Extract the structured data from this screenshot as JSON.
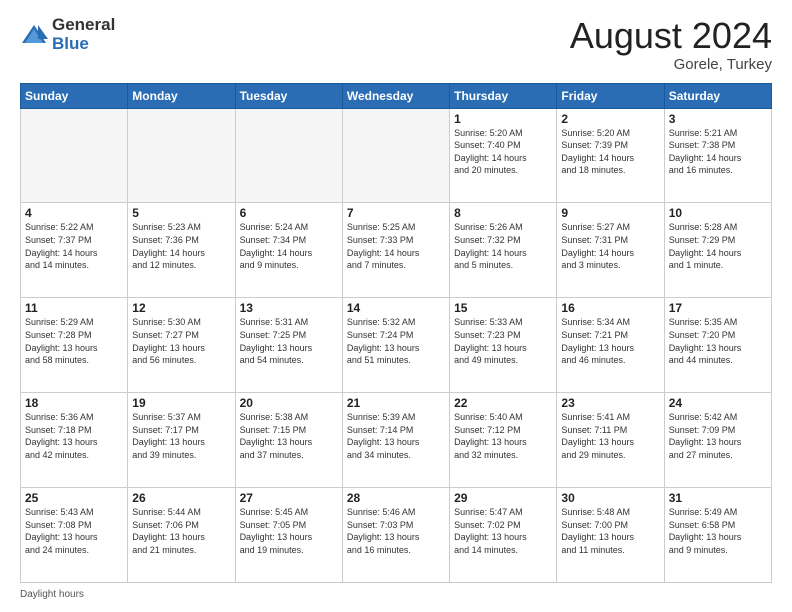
{
  "header": {
    "logo_general": "General",
    "logo_blue": "Blue",
    "month_title": "August 2024",
    "location": "Gorele, Turkey"
  },
  "footer": {
    "daylight_label": "Daylight hours"
  },
  "weekdays": [
    "Sunday",
    "Monday",
    "Tuesday",
    "Wednesday",
    "Thursday",
    "Friday",
    "Saturday"
  ],
  "weeks": [
    [
      {
        "day": "",
        "info": ""
      },
      {
        "day": "",
        "info": ""
      },
      {
        "day": "",
        "info": ""
      },
      {
        "day": "",
        "info": ""
      },
      {
        "day": "1",
        "info": "Sunrise: 5:20 AM\nSunset: 7:40 PM\nDaylight: 14 hours\nand 20 minutes."
      },
      {
        "day": "2",
        "info": "Sunrise: 5:20 AM\nSunset: 7:39 PM\nDaylight: 14 hours\nand 18 minutes."
      },
      {
        "day": "3",
        "info": "Sunrise: 5:21 AM\nSunset: 7:38 PM\nDaylight: 14 hours\nand 16 minutes."
      }
    ],
    [
      {
        "day": "4",
        "info": "Sunrise: 5:22 AM\nSunset: 7:37 PM\nDaylight: 14 hours\nand 14 minutes."
      },
      {
        "day": "5",
        "info": "Sunrise: 5:23 AM\nSunset: 7:36 PM\nDaylight: 14 hours\nand 12 minutes."
      },
      {
        "day": "6",
        "info": "Sunrise: 5:24 AM\nSunset: 7:34 PM\nDaylight: 14 hours\nand 9 minutes."
      },
      {
        "day": "7",
        "info": "Sunrise: 5:25 AM\nSunset: 7:33 PM\nDaylight: 14 hours\nand 7 minutes."
      },
      {
        "day": "8",
        "info": "Sunrise: 5:26 AM\nSunset: 7:32 PM\nDaylight: 14 hours\nand 5 minutes."
      },
      {
        "day": "9",
        "info": "Sunrise: 5:27 AM\nSunset: 7:31 PM\nDaylight: 14 hours\nand 3 minutes."
      },
      {
        "day": "10",
        "info": "Sunrise: 5:28 AM\nSunset: 7:29 PM\nDaylight: 14 hours\nand 1 minute."
      }
    ],
    [
      {
        "day": "11",
        "info": "Sunrise: 5:29 AM\nSunset: 7:28 PM\nDaylight: 13 hours\nand 58 minutes."
      },
      {
        "day": "12",
        "info": "Sunrise: 5:30 AM\nSunset: 7:27 PM\nDaylight: 13 hours\nand 56 minutes."
      },
      {
        "day": "13",
        "info": "Sunrise: 5:31 AM\nSunset: 7:25 PM\nDaylight: 13 hours\nand 54 minutes."
      },
      {
        "day": "14",
        "info": "Sunrise: 5:32 AM\nSunset: 7:24 PM\nDaylight: 13 hours\nand 51 minutes."
      },
      {
        "day": "15",
        "info": "Sunrise: 5:33 AM\nSunset: 7:23 PM\nDaylight: 13 hours\nand 49 minutes."
      },
      {
        "day": "16",
        "info": "Sunrise: 5:34 AM\nSunset: 7:21 PM\nDaylight: 13 hours\nand 46 minutes."
      },
      {
        "day": "17",
        "info": "Sunrise: 5:35 AM\nSunset: 7:20 PM\nDaylight: 13 hours\nand 44 minutes."
      }
    ],
    [
      {
        "day": "18",
        "info": "Sunrise: 5:36 AM\nSunset: 7:18 PM\nDaylight: 13 hours\nand 42 minutes."
      },
      {
        "day": "19",
        "info": "Sunrise: 5:37 AM\nSunset: 7:17 PM\nDaylight: 13 hours\nand 39 minutes."
      },
      {
        "day": "20",
        "info": "Sunrise: 5:38 AM\nSunset: 7:15 PM\nDaylight: 13 hours\nand 37 minutes."
      },
      {
        "day": "21",
        "info": "Sunrise: 5:39 AM\nSunset: 7:14 PM\nDaylight: 13 hours\nand 34 minutes."
      },
      {
        "day": "22",
        "info": "Sunrise: 5:40 AM\nSunset: 7:12 PM\nDaylight: 13 hours\nand 32 minutes."
      },
      {
        "day": "23",
        "info": "Sunrise: 5:41 AM\nSunset: 7:11 PM\nDaylight: 13 hours\nand 29 minutes."
      },
      {
        "day": "24",
        "info": "Sunrise: 5:42 AM\nSunset: 7:09 PM\nDaylight: 13 hours\nand 27 minutes."
      }
    ],
    [
      {
        "day": "25",
        "info": "Sunrise: 5:43 AM\nSunset: 7:08 PM\nDaylight: 13 hours\nand 24 minutes."
      },
      {
        "day": "26",
        "info": "Sunrise: 5:44 AM\nSunset: 7:06 PM\nDaylight: 13 hours\nand 21 minutes."
      },
      {
        "day": "27",
        "info": "Sunrise: 5:45 AM\nSunset: 7:05 PM\nDaylight: 13 hours\nand 19 minutes."
      },
      {
        "day": "28",
        "info": "Sunrise: 5:46 AM\nSunset: 7:03 PM\nDaylight: 13 hours\nand 16 minutes."
      },
      {
        "day": "29",
        "info": "Sunrise: 5:47 AM\nSunset: 7:02 PM\nDaylight: 13 hours\nand 14 minutes."
      },
      {
        "day": "30",
        "info": "Sunrise: 5:48 AM\nSunset: 7:00 PM\nDaylight: 13 hours\nand 11 minutes."
      },
      {
        "day": "31",
        "info": "Sunrise: 5:49 AM\nSunset: 6:58 PM\nDaylight: 13 hours\nand 9 minutes."
      }
    ]
  ]
}
